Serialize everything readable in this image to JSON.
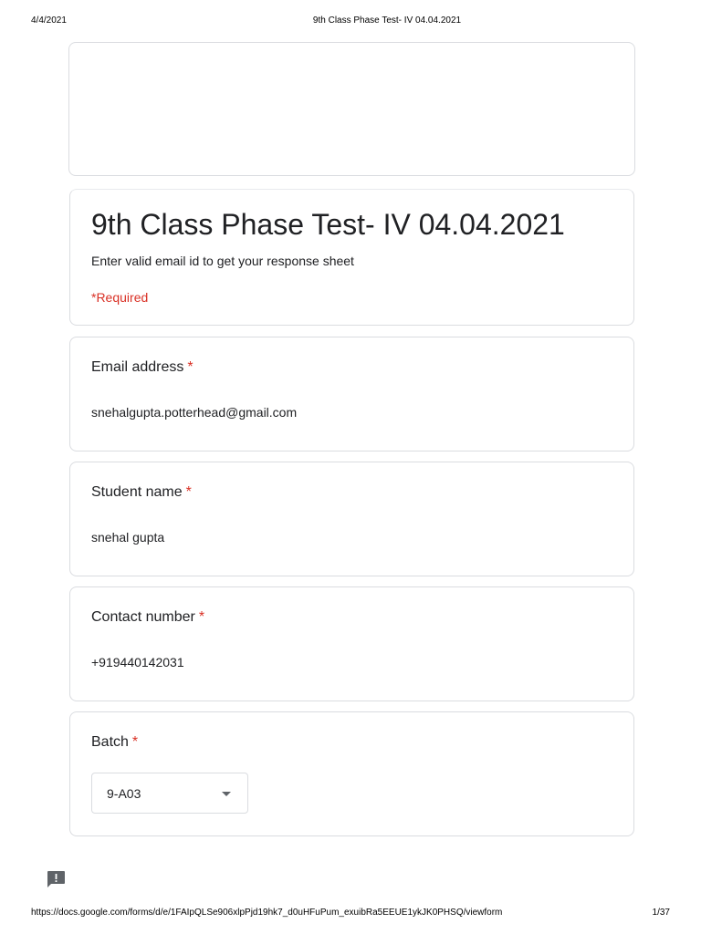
{
  "print_header": {
    "date": "4/4/2021",
    "title": "9th Class Phase Test- IV 04.04.2021"
  },
  "form": {
    "title": "9th Class Phase Test- IV 04.04.2021",
    "description": "Enter valid email id to get your response sheet",
    "required_note": "*Required"
  },
  "questions": [
    {
      "label": "Email address",
      "required_mark": "*",
      "answer": "snehalgupta.potterhead@gmail.com"
    },
    {
      "label": "Student name",
      "required_mark": "*",
      "answer": "snehal gupta"
    },
    {
      "label": "Contact number",
      "required_mark": "*",
      "answer": "+919440142031"
    },
    {
      "label": "Batch",
      "required_mark": "*",
      "selected": "9-A03",
      "control": "dropdown"
    }
  ],
  "icons": {
    "feedback": "feedback-icon",
    "dropdown_arrow": "dropdown-arrow-icon"
  },
  "colors": {
    "required": "#d93025",
    "border": "#dadce0",
    "text": "#202124"
  },
  "print_footer": {
    "url": "https://docs.google.com/forms/d/e/1FAIpQLSe906xlpPjd19hk7_d0uHFuPum_exuibRa5EEUE1ykJK0PHSQ/viewform",
    "page": "1/37"
  }
}
